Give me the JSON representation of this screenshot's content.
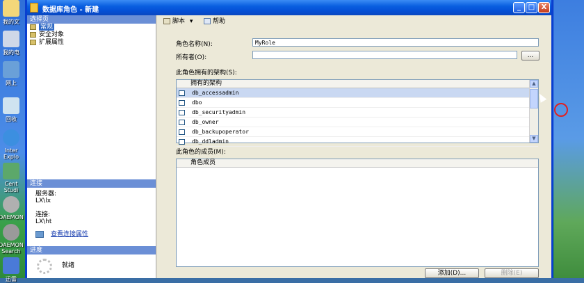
{
  "window": {
    "title": "数据库角色 - 新建",
    "controls": [
      "_",
      "□",
      "X"
    ]
  },
  "desktop_icons": [
    {
      "label": "我的文"
    },
    {
      "label": "我的电"
    },
    {
      "label": "网上"
    },
    {
      "label": "回收"
    },
    {
      "label": "Inter Explo"
    },
    {
      "label": "Cent Studi"
    },
    {
      "label": "DAEMON"
    },
    {
      "label": "DAEMON Search"
    },
    {
      "label": "迅雷"
    }
  ],
  "left": {
    "select_page_header": "选择页",
    "nav_items": [
      {
        "label": "常规",
        "selected": true
      },
      {
        "label": "安全对象",
        "selected": false
      },
      {
        "label": "扩展属性",
        "selected": false
      }
    ],
    "connection_header": "连接",
    "server_label": "服务器:",
    "server_value": "LX\\lx",
    "connection_label": "连接:",
    "connection_value": "LX\\ht",
    "view_conn_props": "查看连接属性",
    "progress_header": "进度",
    "progress_status": "就绪"
  },
  "toolbar": {
    "script_label": "脚本",
    "help_label": "帮助"
  },
  "form": {
    "role_name_label": "角色名称(N):",
    "role_name_value": "MyRole",
    "owner_label": "所有者(O):",
    "owner_value": "",
    "browse_button": "...",
    "schemas_label": "此角色拥有的架构(S):",
    "schemas_header": "拥有的架构",
    "schemas": [
      {
        "name": "db_accessadmin",
        "checked": false
      },
      {
        "name": "dbo",
        "checked": false
      },
      {
        "name": "db_securityadmin",
        "checked": false
      },
      {
        "name": "db_owner",
        "checked": false
      },
      {
        "name": "db_backupoperator",
        "checked": false
      },
      {
        "name": "db_ddladmin",
        "checked": false
      }
    ],
    "members_label": "此角色的成员(M):",
    "members_header": "角色成员",
    "add_button": "添加(D)...",
    "remove_button": "删除(E)"
  },
  "colors": {
    "titlebar": "#0550d6",
    "section_header": "#6b8fd6",
    "selection": "#316ac5",
    "annotation_circle": "#e02020"
  }
}
